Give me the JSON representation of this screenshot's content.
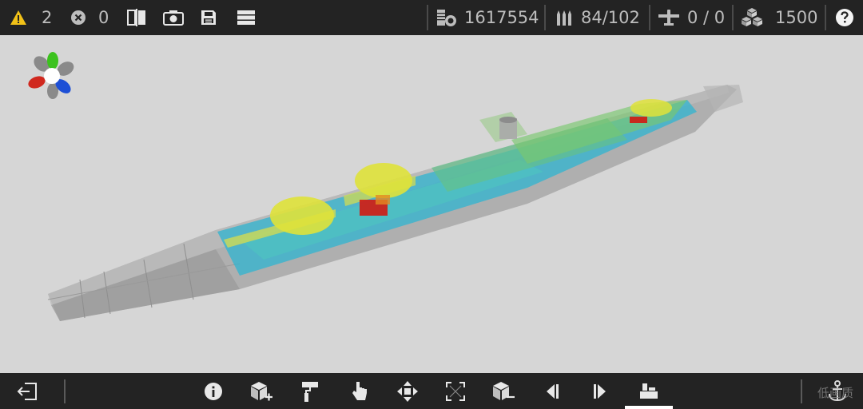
{
  "top": {
    "warnings": "2",
    "errors": "0",
    "cost": "1617554",
    "ammo": "84/102",
    "aircraft": "0 / 0",
    "blocks": "1500"
  },
  "watermark": "低画质",
  "icons": {
    "warning": "warning-icon",
    "error": "error-icon",
    "mirror": "mirror-icon",
    "camera": "camera-icon",
    "save": "save-icon",
    "menu": "menu-icon",
    "coins": "coins-icon",
    "ammo": "ammo-icon",
    "plane": "plane-icon",
    "blocks": "blocks-icon",
    "help": "help-icon"
  },
  "colors": {
    "bar": "#232323",
    "viewport": "#d6d6d6",
    "warning": "#f2c218",
    "axis_x": "#d0281e",
    "axis_y": "#3cc21e",
    "axis_z": "#1d4fd6"
  }
}
